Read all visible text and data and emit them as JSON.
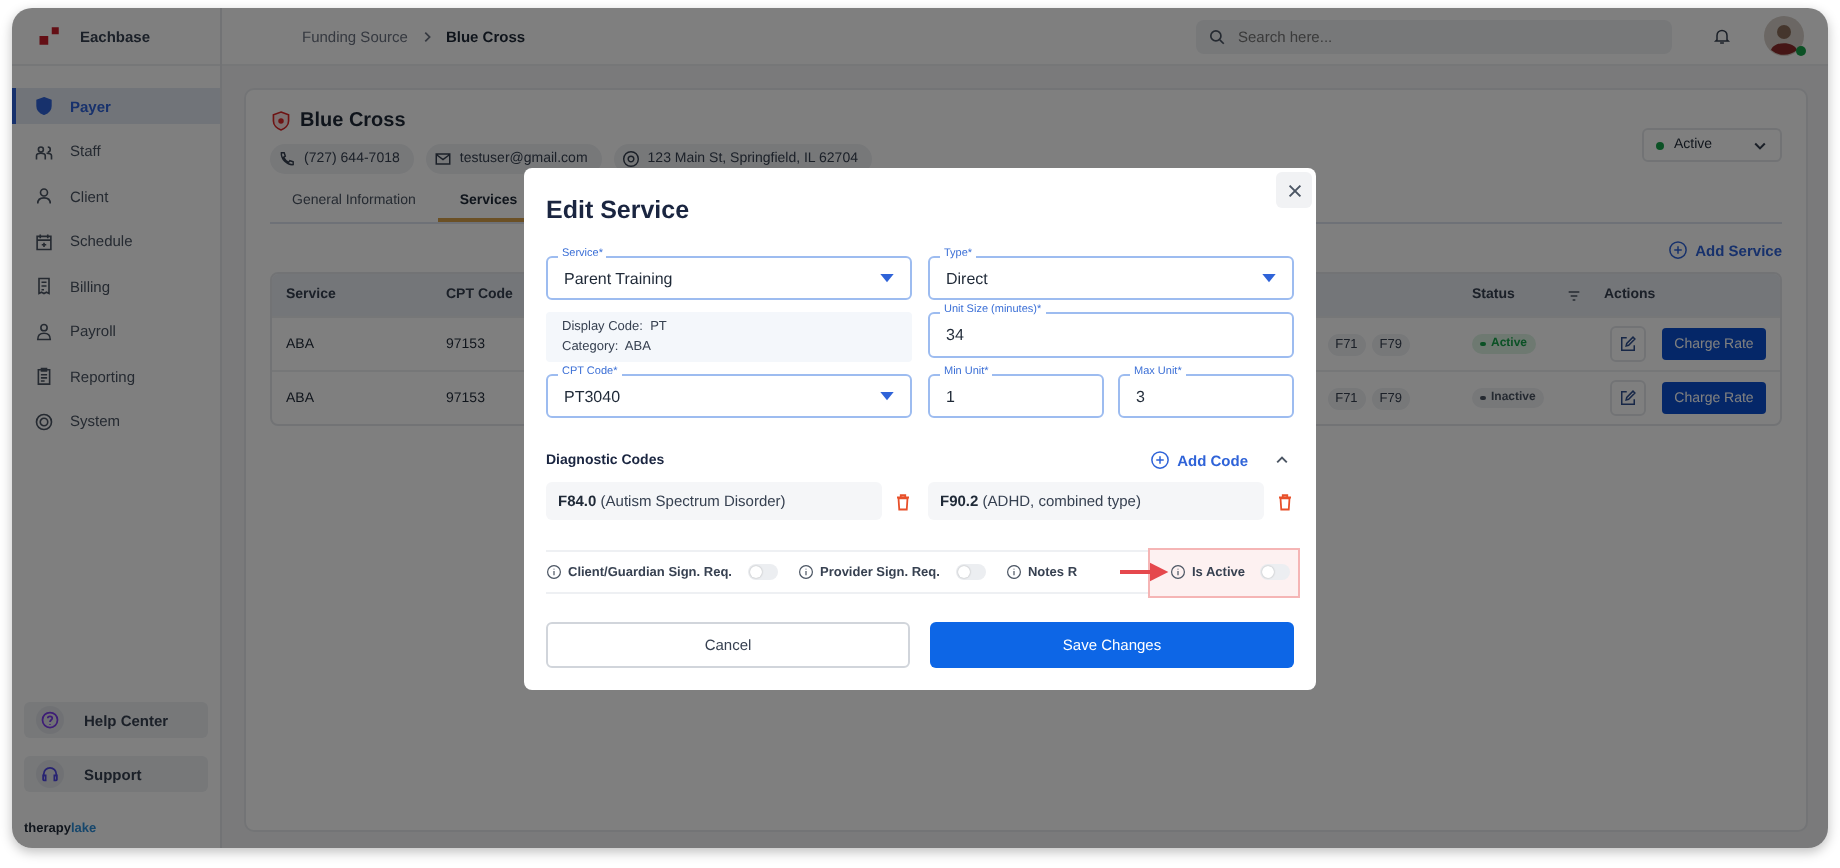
{
  "app": {
    "name": "Eachbase"
  },
  "breadcrumb": [
    "Funding Source",
    "Blue Cross"
  ],
  "search": {
    "placeholder": "Search here..."
  },
  "user": {
    "online": true
  },
  "sidebar": {
    "items": [
      {
        "label": "Payer",
        "selected": true
      },
      {
        "label": "Staff",
        "selected": false
      },
      {
        "label": "Client",
        "selected": false
      },
      {
        "label": "Schedule",
        "selected": false
      },
      {
        "label": "Billing",
        "selected": false
      },
      {
        "label": "Payroll",
        "selected": false
      },
      {
        "label": "Reporting",
        "selected": false
      },
      {
        "label": "System",
        "selected": false
      }
    ],
    "bottom": [
      {
        "label": "Help Center"
      },
      {
        "label": "Support"
      }
    ],
    "brand": {
      "first": "therapy",
      "second": "lake"
    }
  },
  "payer": {
    "name": "Blue Cross",
    "status": {
      "label": "Active"
    },
    "contacts": [
      {
        "kind": "phone",
        "text": "(727) 644-7018"
      },
      {
        "kind": "email",
        "text": "testuser@gmail.com"
      },
      {
        "kind": "address",
        "text": "123 Main St, Springfield, IL 62704"
      }
    ]
  },
  "tabs": [
    {
      "label": "General Information",
      "selected": false
    },
    {
      "label": "Services",
      "selected": true
    }
  ],
  "add_service": "Add Service",
  "table": {
    "columns": [
      "Service",
      "CPT Code",
      "Status",
      "Actions"
    ],
    "rows": [
      {
        "service": "ABA",
        "cpt": "97153",
        "codes": [
          "F71",
          "F79"
        ],
        "status": "Active",
        "active": true,
        "action": "Charge Rate"
      },
      {
        "service": "ABA",
        "cpt": "97153",
        "codes": [
          "F71",
          "F79"
        ],
        "status": "Inactive",
        "active": false,
        "action": "Charge Rate"
      }
    ]
  },
  "modal": {
    "title": "Edit Service",
    "service": {
      "label": "Service*",
      "value": "Parent Training"
    },
    "type": {
      "label": "Type*",
      "value": "Direct"
    },
    "info": [
      {
        "label": "Display Code:",
        "value": "PT"
      },
      {
        "label": "Category:",
        "value": "ABA"
      }
    ],
    "unit_size": {
      "label": "Unit Size (minutes)*",
      "value": "34"
    },
    "cpt_code": {
      "label": "CPT Code*",
      "value": "PT3040"
    },
    "min_unit": {
      "label": "Min Unit*",
      "value": "1"
    },
    "max_unit": {
      "label": "Max Unit*",
      "value": "3"
    },
    "diagnostic": {
      "title": "Diagnostic Codes",
      "add": "Add Code",
      "expanded": true,
      "codes": [
        {
          "code": "F84.0",
          "desc": "(Autism Spectrum Disorder)"
        },
        {
          "code": "F90.2",
          "desc": "(ADHD, combined type)"
        }
      ]
    },
    "toggles": [
      {
        "label": "Client/Guardian Sign. Req.",
        "on": false,
        "highlighted": false
      },
      {
        "label": "Provider Sign. Req.",
        "on": false,
        "highlighted": false
      },
      {
        "label": "Notes R",
        "highlighted": false
      },
      {
        "label": "Is Active",
        "on": false,
        "highlighted": true
      }
    ],
    "cancel": "Cancel",
    "save": "Save Changes"
  }
}
